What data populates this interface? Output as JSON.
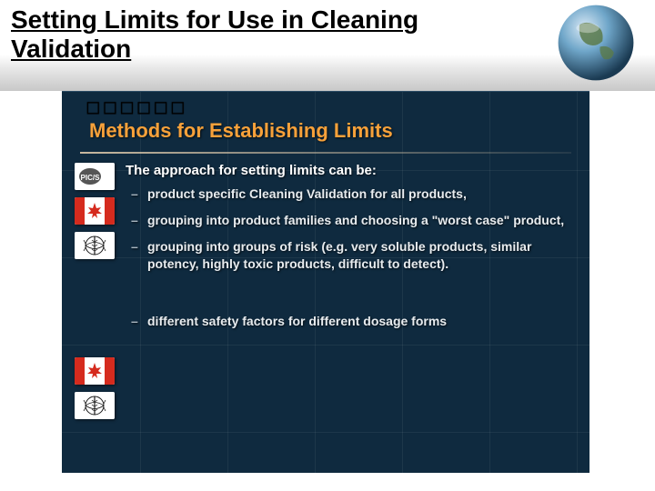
{
  "header": {
    "title": "Setting Limits for Use in Cleaning Validation"
  },
  "section": {
    "scribble": "◻◻◻◻◻◻",
    "title": "Methods for Establishing Limits",
    "lead": "The approach for setting limits can be:",
    "bullets": [
      "product specific Cleaning Validation for all products,",
      "grouping into product families and choosing a \"worst case\" product,",
      "grouping into groups of risk (e.g. very soluble products, similar potency, highly toxic products, difficult to detect).",
      "different safety factors for different dosage forms"
    ]
  },
  "icons": {
    "globe": "globe-icon",
    "pics": "PIC/S",
    "canada": "canada-flag",
    "who": "who-logo"
  }
}
